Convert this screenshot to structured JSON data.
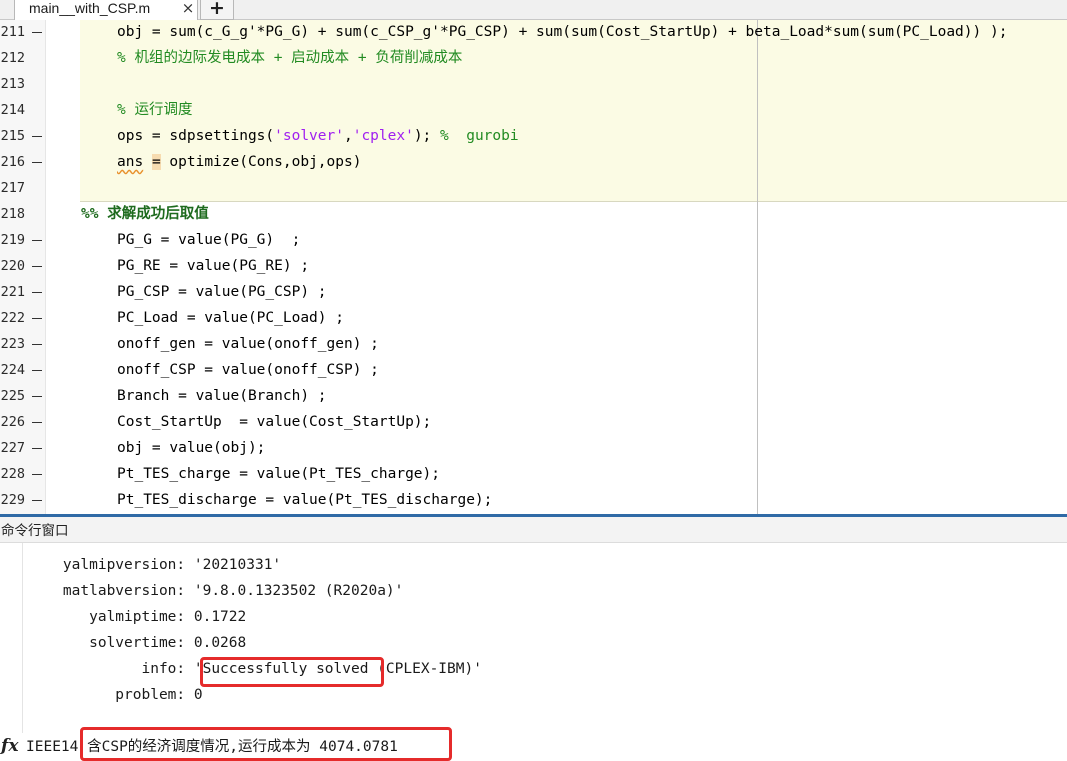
{
  "tab": {
    "filename": "main__with_CSP.m",
    "close_glyph": "×",
    "add_glyph": "+"
  },
  "editor": {
    "lines": [
      {
        "num": "211",
        "mark": true,
        "kind": "code",
        "parts": [
          {
            "t": "obj = sum(c_G_g'*PG_G) + sum(c_CSP_g'*PG_CSP) + sum(sum(Cost_StartUp) + beta_Load*sum(sum(PC_Load)) );"
          }
        ]
      },
      {
        "num": "212",
        "mark": false,
        "kind": "comment",
        "parts": [
          {
            "t": "% 机组的边际发电成本 + 启动成本 + 负荷削减成本"
          }
        ]
      },
      {
        "num": "213",
        "mark": false,
        "kind": "code",
        "parts": []
      },
      {
        "num": "214",
        "mark": false,
        "kind": "comment",
        "parts": [
          {
            "t": "% 运行调度"
          }
        ]
      },
      {
        "num": "215",
        "mark": true,
        "kind": "code",
        "parts": [
          {
            "t": "ops = sdpsettings("
          },
          {
            "t": "'solver'",
            "c": "str"
          },
          {
            "t": ","
          },
          {
            "t": "'cplex'",
            "c": "str"
          },
          {
            "t": "); "
          },
          {
            "t": "%  gurobi",
            "c": "cmt"
          }
        ]
      },
      {
        "num": "216",
        "mark": true,
        "kind": "code",
        "parts": [
          {
            "t": "ans",
            "c": "warn"
          },
          {
            "t": " "
          },
          {
            "t": "=",
            "c": "warn-box"
          },
          {
            "t": " optimize(Cons,obj,ops)"
          }
        ]
      },
      {
        "num": "217",
        "mark": false,
        "kind": "code",
        "parts": []
      },
      {
        "num": "218",
        "mark": false,
        "kind": "section",
        "parts": [
          {
            "t": "%% 求解成功后取值"
          }
        ]
      },
      {
        "num": "219",
        "mark": true,
        "kind": "code",
        "parts": [
          {
            "t": "PG_G = value(PG_G)  ;"
          }
        ]
      },
      {
        "num": "220",
        "mark": true,
        "kind": "code",
        "parts": [
          {
            "t": "PG_RE = value(PG_RE) ;"
          }
        ]
      },
      {
        "num": "221",
        "mark": true,
        "kind": "code",
        "parts": [
          {
            "t": "PG_CSP = value(PG_CSP) ;"
          }
        ]
      },
      {
        "num": "222",
        "mark": true,
        "kind": "code",
        "parts": [
          {
            "t": "PC_Load = value(PC_Load) ;"
          }
        ]
      },
      {
        "num": "223",
        "mark": true,
        "kind": "code",
        "parts": [
          {
            "t": "onoff_gen = value(onoff_gen) ;"
          }
        ]
      },
      {
        "num": "224",
        "mark": true,
        "kind": "code",
        "parts": [
          {
            "t": "onoff_CSP = value(onoff_CSP) ;"
          }
        ]
      },
      {
        "num": "225",
        "mark": true,
        "kind": "code",
        "parts": [
          {
            "t": "Branch = value(Branch) ;"
          }
        ]
      },
      {
        "num": "226",
        "mark": true,
        "kind": "code",
        "parts": [
          {
            "t": "Cost_StartUp  = value(Cost_StartUp);"
          }
        ]
      },
      {
        "num": "227",
        "mark": true,
        "kind": "code",
        "parts": [
          {
            "t": "obj = value(obj);"
          }
        ]
      },
      {
        "num": "228",
        "mark": true,
        "kind": "code",
        "parts": [
          {
            "t": "Pt_TES_charge = value(Pt_TES_charge);"
          }
        ]
      },
      {
        "num": "229",
        "mark": true,
        "kind": "code",
        "parts": [
          {
            "t": "Pt_TES_discharge = value(Pt_TES_discharge);"
          }
        ]
      }
    ]
  },
  "command_window": {
    "title": "命令行窗口",
    "output": [
      "    yalmipversion: '20210331'",
      "    matlabversion: '9.8.0.1323502 (R2020a)'",
      "       yalmiptime: 0.1722",
      "       solvertime: 0.0268",
      "             info: 'Successfully solved (CPLEX-IBM)'",
      "          problem: 0"
    ],
    "final_line": "IEEE14 含CSP的经济调度情况,运行成本为 4074.0781",
    "prompt_icon": "fx-icon"
  },
  "colors": {
    "comment": "#228b22",
    "string": "#a020f0",
    "cell_highlight": "#fbfbe4",
    "splitter": "#2f6aa6",
    "highlight_box": "#e52b2b"
  }
}
